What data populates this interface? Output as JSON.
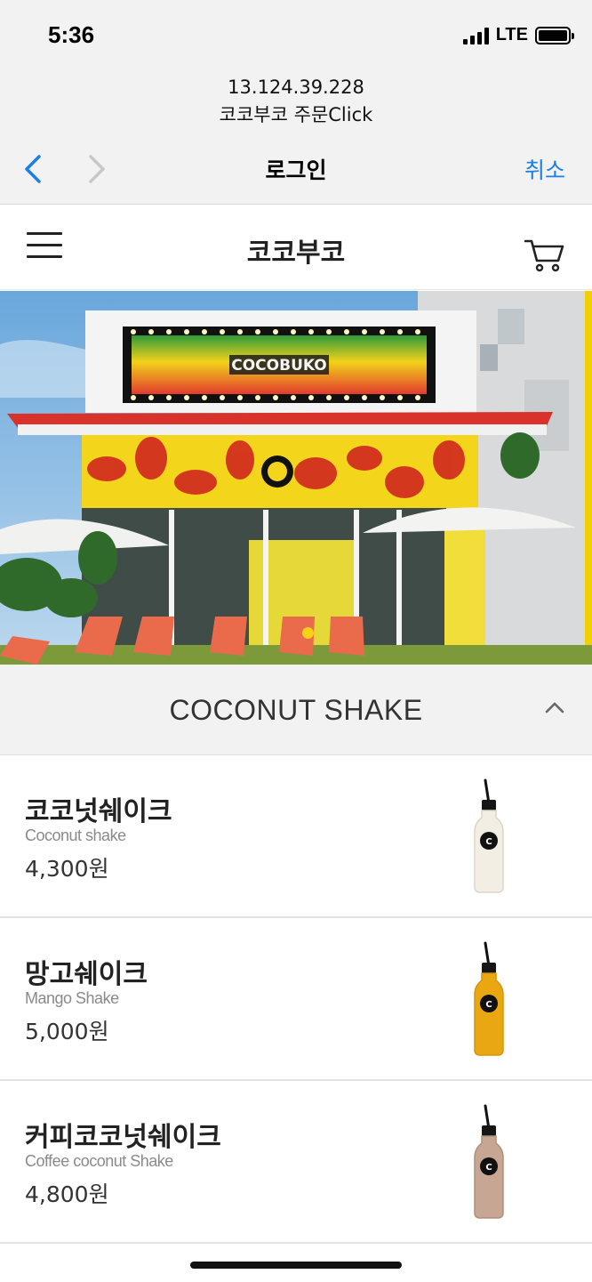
{
  "status": {
    "time": "5:36",
    "network": "LTE"
  },
  "browser": {
    "host": "13.124.39.228",
    "page_title": "코코부코 주문Click",
    "nav_title": "로그인",
    "cancel_label": "취소"
  },
  "app": {
    "store_name": "코코부코"
  },
  "hero": {
    "sign_text": "COCOBUKO"
  },
  "category": {
    "title": "COCONUT SHAKE"
  },
  "menu_items": [
    {
      "name": "코코넛쉐이크",
      "name_en": "Coconut shake",
      "price": "4,300원",
      "bottle_color": "#f2eee4"
    },
    {
      "name": "망고쉐이크",
      "name_en": "Mango Shake",
      "price": "5,000원",
      "bottle_color": "#e9a712"
    },
    {
      "name": "커피코코넛쉐이크",
      "name_en": "Coffee coconut Shake",
      "price": "4,800원",
      "bottle_color": "#c7a793"
    }
  ],
  "colors": {
    "ios_blue": "#1a7fe6",
    "chrome_bg": "#f2f2f2",
    "carousel_active_dot": "#f7d117"
  }
}
